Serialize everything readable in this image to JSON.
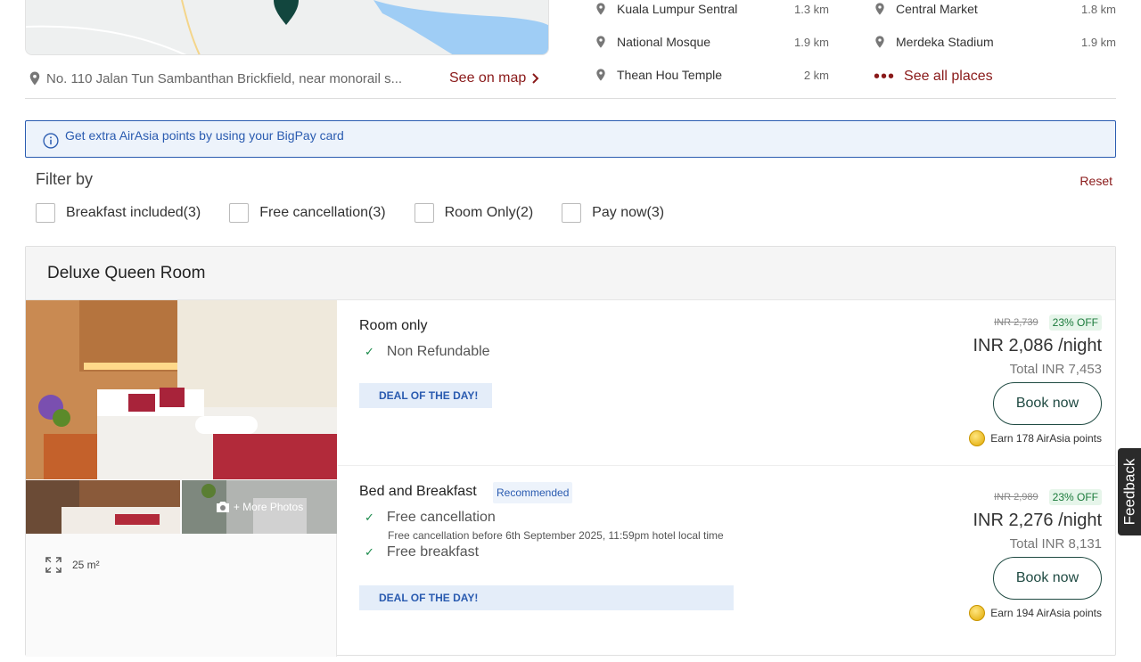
{
  "location": {
    "address": "No. 110 Jalan Tun Sambanthan Brickfield, near monorail s...",
    "see_on_map": "See on map",
    "places": [
      {
        "name": "Kuala Lumpur Sentral",
        "distance": "1.3 km"
      },
      {
        "name": "Central Market",
        "distance": "1.8 km"
      },
      {
        "name": "National Mosque",
        "distance": "1.9 km"
      },
      {
        "name": "Merdeka Stadium",
        "distance": "1.9 km"
      },
      {
        "name": "Thean Hou Temple",
        "distance": "2 km"
      }
    ],
    "see_all_places": "See all places"
  },
  "banner": {
    "text": "Get extra AirAsia points by using your BigPay card"
  },
  "filters": {
    "title": "Filter by",
    "reset": "Reset",
    "options": [
      {
        "label": "Breakfast included(3)",
        "checked": false
      },
      {
        "label": "Free cancellation(3)",
        "checked": false
      },
      {
        "label": "Room Only(2)",
        "checked": false
      },
      {
        "label": "Pay now(3)",
        "checked": false
      }
    ]
  },
  "room": {
    "title": "Deluxe Queen Room",
    "more_photos": "+ More Photos",
    "size": "25 m²",
    "offers": [
      {
        "title": "Room only",
        "features": [
          {
            "label": "Non Refundable"
          }
        ],
        "deal": "DEAL OF THE DAY!",
        "original_price": "INR 2,739",
        "discount": "23% OFF",
        "price": "INR 2,086 /night",
        "total": "Total INR 7,453",
        "book": "Book now",
        "earn": "Earn 178 AirAsia points"
      },
      {
        "title": "Bed and Breakfast",
        "badge": "Recommended",
        "features": [
          {
            "label": "Free cancellation",
            "sub": "Free cancellation before 6th September 2025, 11:59pm hotel local time"
          },
          {
            "label": "Free breakfast"
          }
        ],
        "deal": "DEAL OF THE DAY!",
        "original_price": "INR 2,989",
        "discount": "23% OFF",
        "price": "INR 2,276 /night",
        "total": "Total INR 8,131",
        "book": "Book now",
        "earn": "Earn 194 AirAsia points"
      }
    ]
  },
  "feedback": "Feedback",
  "colors": {
    "accent_link": "#8a1a1a",
    "info_blue": "#2a5bb0",
    "book_green": "#1f4a42"
  }
}
